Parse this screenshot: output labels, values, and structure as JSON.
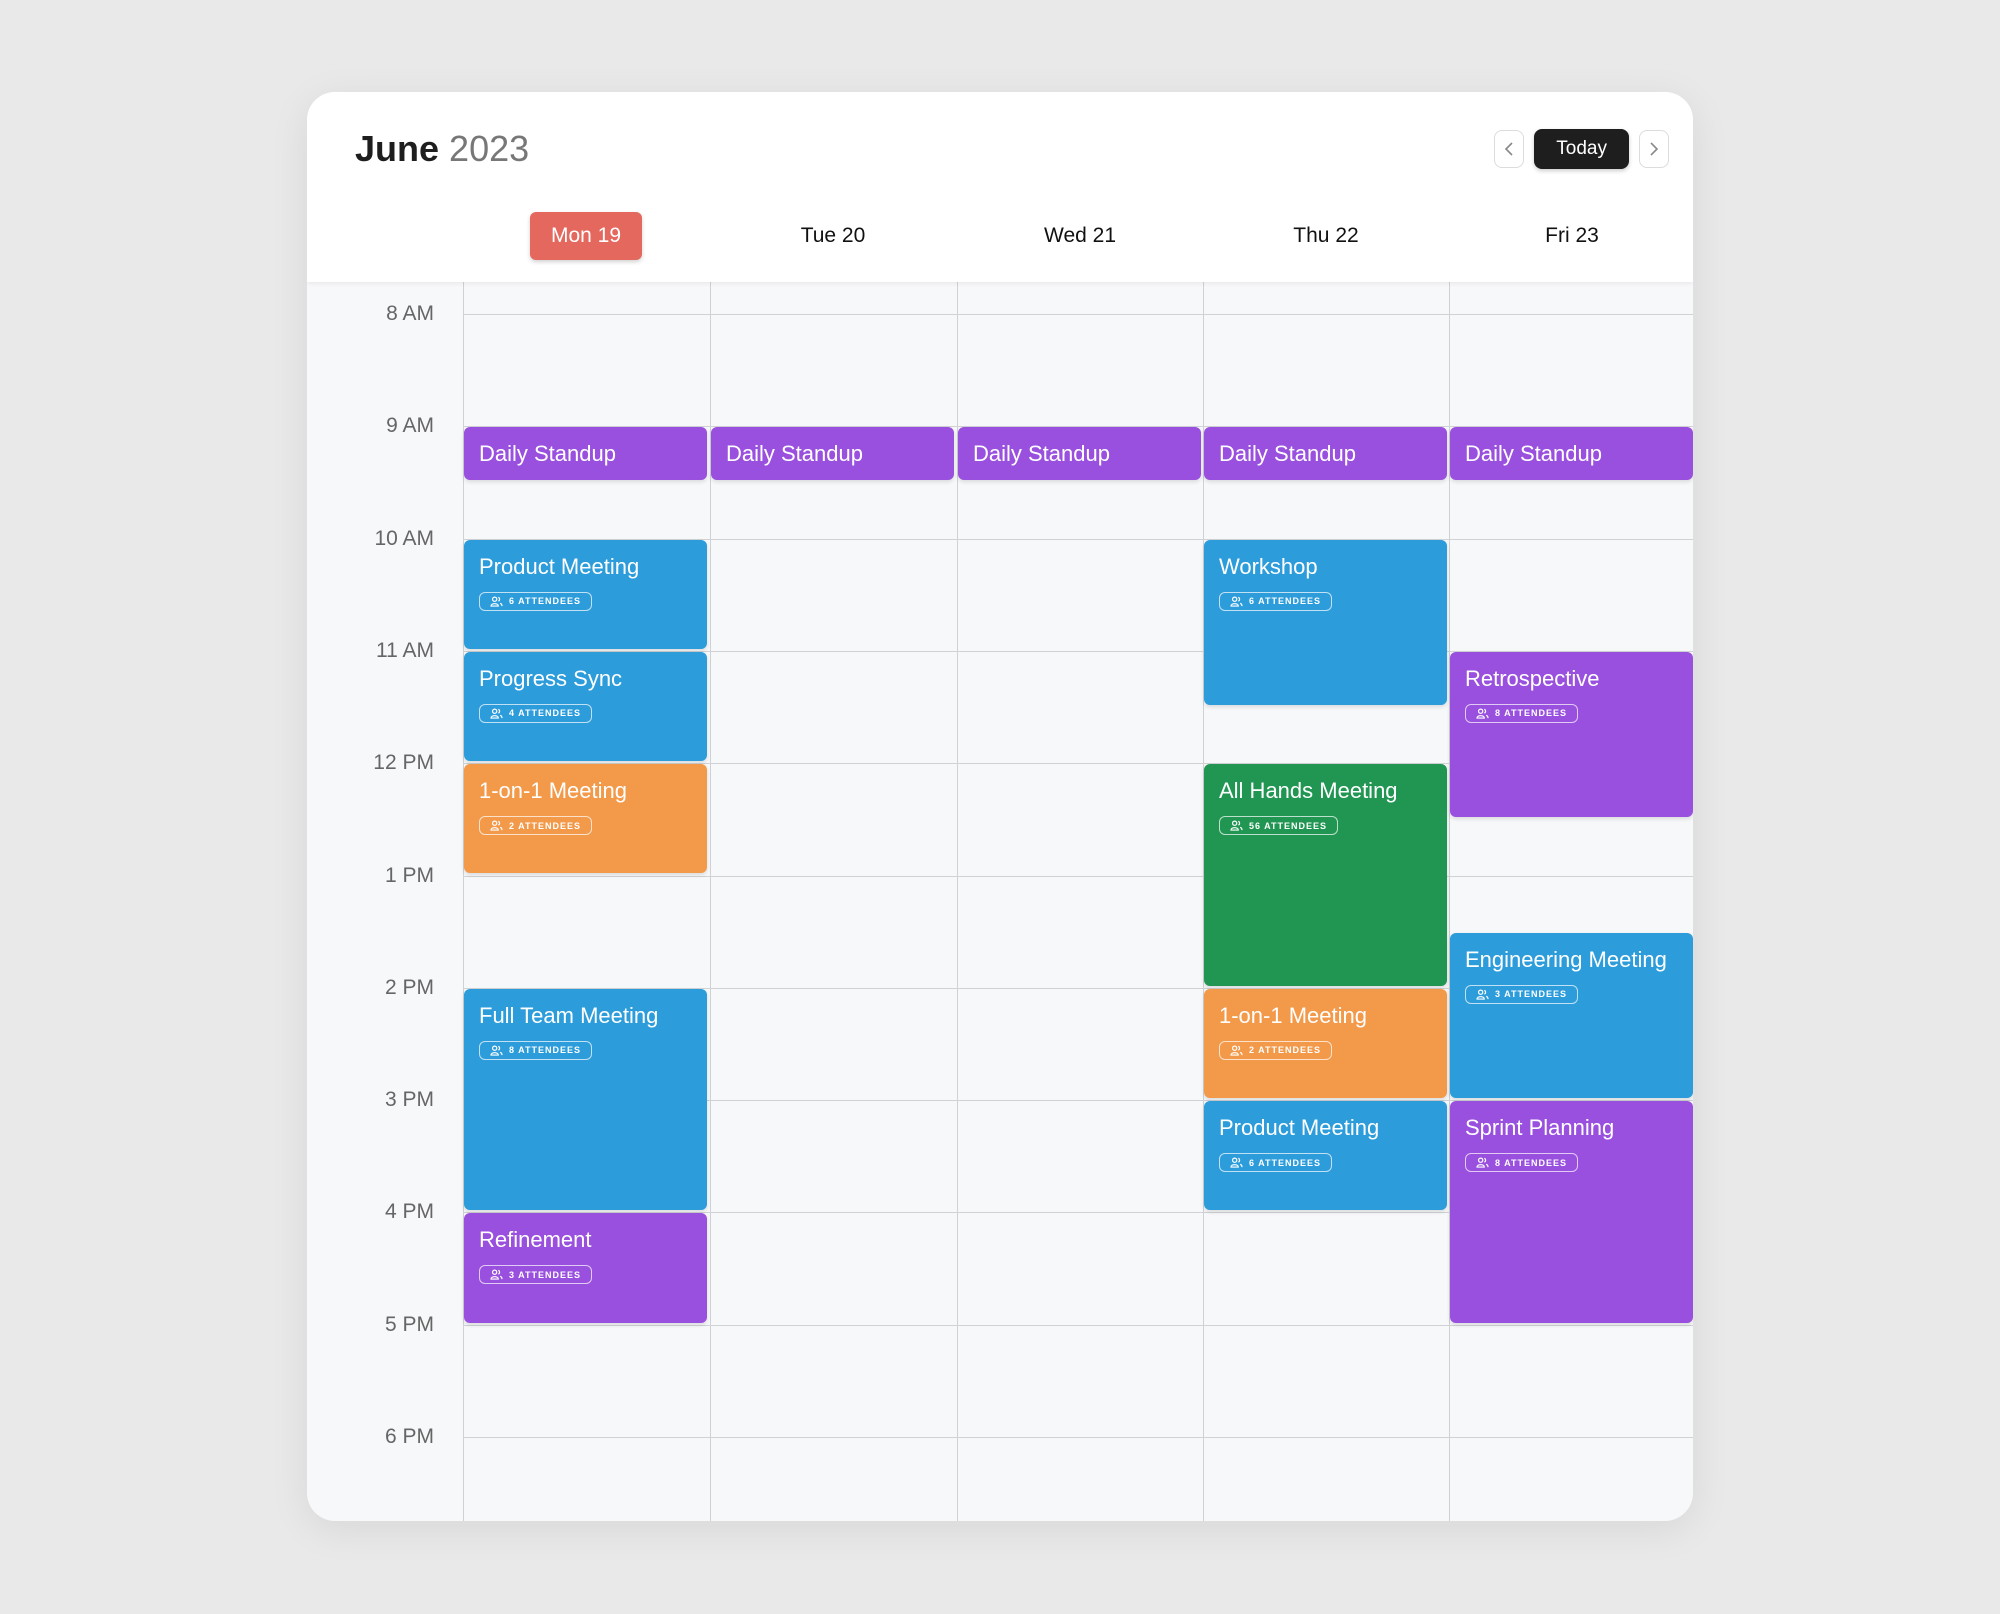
{
  "header": {
    "month": "June",
    "year": "2023",
    "today_label": "Today",
    "prev_icon": "chevron-left-icon",
    "next_icon": "chevron-right-icon"
  },
  "days": [
    {
      "label": "Mon 19",
      "active": true
    },
    {
      "label": "Tue 20",
      "active": false
    },
    {
      "label": "Wed 21",
      "active": false
    },
    {
      "label": "Thu 22",
      "active": false
    },
    {
      "label": "Fri 23",
      "active": false
    }
  ],
  "hours": [
    "8 AM",
    "9 AM",
    "10 AM",
    "11 AM",
    "12 PM",
    "1 PM",
    "2 PM",
    "3 PM",
    "4 PM",
    "5 PM",
    "6 PM"
  ],
  "colors": {
    "purple": "#9a50de",
    "blue": "#2d9cdb",
    "orange": "#f2994a",
    "green": "#219653",
    "today": "#e5685e"
  },
  "events": [
    {
      "day": 0,
      "title": "Daily Standup",
      "start": 9,
      "end": 9.5,
      "color": "purple"
    },
    {
      "day": 1,
      "title": "Daily Standup",
      "start": 9,
      "end": 9.5,
      "color": "purple"
    },
    {
      "day": 2,
      "title": "Daily Standup",
      "start": 9,
      "end": 9.5,
      "color": "purple"
    },
    {
      "day": 3,
      "title": "Daily Standup",
      "start": 9,
      "end": 9.5,
      "color": "purple"
    },
    {
      "day": 4,
      "title": "Daily Standup",
      "start": 9,
      "end": 9.5,
      "color": "purple"
    },
    {
      "day": 0,
      "title": "Product Meeting",
      "start": 10,
      "end": 11,
      "color": "blue",
      "attendees": "6 ATTENDEES"
    },
    {
      "day": 0,
      "title": "Progress Sync",
      "start": 11,
      "end": 12,
      "color": "blue",
      "attendees": "4 ATTENDEES"
    },
    {
      "day": 0,
      "title": "1-on-1 Meeting",
      "start": 12,
      "end": 13,
      "color": "orange",
      "attendees": "2 ATTENDEES"
    },
    {
      "day": 0,
      "title": "Full Team Meeting",
      "start": 14,
      "end": 16,
      "color": "blue",
      "attendees": "8 ATTENDEES"
    },
    {
      "day": 0,
      "title": "Refinement",
      "start": 16,
      "end": 17,
      "color": "purple",
      "attendees": "3 ATTENDEES"
    },
    {
      "day": 3,
      "title": "Workshop",
      "start": 10,
      "end": 11.5,
      "color": "blue",
      "attendees": "6 ATTENDEES"
    },
    {
      "day": 3,
      "title": "All Hands Meeting",
      "start": 12,
      "end": 14,
      "color": "green",
      "attendees": "56 ATTENDEES"
    },
    {
      "day": 3,
      "title": "1-on-1 Meeting",
      "start": 14,
      "end": 15,
      "color": "orange",
      "attendees": "2 ATTENDEES"
    },
    {
      "day": 3,
      "title": "Product Meeting",
      "start": 15,
      "end": 16,
      "color": "blue",
      "attendees": "6 ATTENDEES"
    },
    {
      "day": 4,
      "title": "Retrospective",
      "start": 11,
      "end": 12.5,
      "color": "purple",
      "attendees": "8 ATTENDEES"
    },
    {
      "day": 4,
      "title": "Engineering Meeting",
      "start": 13.5,
      "end": 15,
      "color": "blue",
      "attendees": "3 ATTENDEES"
    },
    {
      "day": 4,
      "title": "Sprint Planning",
      "start": 15,
      "end": 17,
      "color": "purple",
      "attendees": "8 ATTENDEES"
    }
  ]
}
